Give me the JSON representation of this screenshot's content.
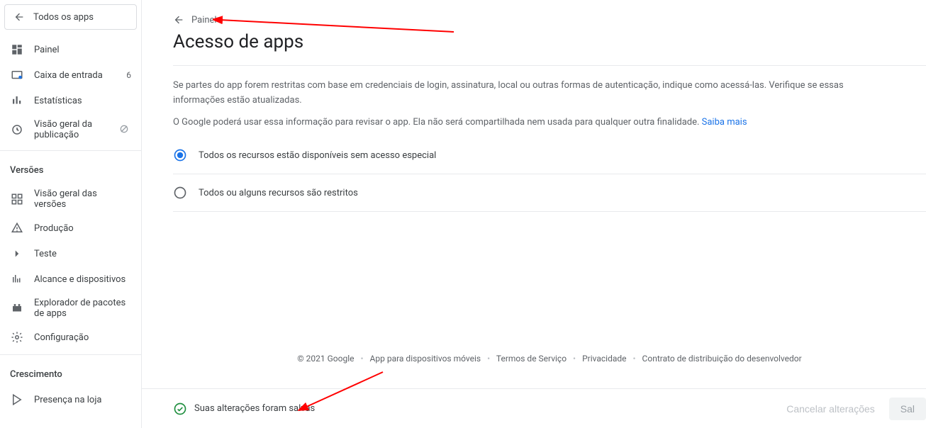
{
  "allApps": "Todos os apps",
  "nav": {
    "painel": "Painel",
    "caixa": "Caixa de entrada",
    "caixa_count": "6",
    "estatisticas": "Estatísticas",
    "visao_pub": "Visão geral da publicação"
  },
  "sec_versoes_title": "Versões",
  "versoes": {
    "visao": "Visão geral das versões",
    "producao": "Produção",
    "teste": "Teste",
    "alcance": "Alcance e dispositivos",
    "explorador": "Explorador de pacotes de apps",
    "config": "Configuração"
  },
  "sec_crescimento_title": "Crescimento",
  "crescimento": {
    "presenca": "Presença na loja"
  },
  "breadcrumb": "Painel",
  "page_title": "Acesso de apps",
  "intro_p1": "Se partes do app forem restritas com base em credenciais de login, assinatura, local ou outras formas de autenticação, indique como acessá-las. Verifique se essas informações estão atualizadas.",
  "intro_p2a": "O Google poderá usar essa informação para revisar o app. Ela não será compartilhada nem usada para qualquer outra finalidade. ",
  "intro_link": "Saiba mais",
  "radio1": "Todos os recursos estão disponíveis sem acesso especial",
  "radio2": "Todos ou alguns recursos são restritos",
  "footer": {
    "copyright": "© 2021 Google",
    "l1": "App para dispositivos móveis",
    "l2": "Termos de Serviço",
    "l3": "Privacidade",
    "l4": "Contrato de distribuição do desenvolvedor"
  },
  "save_msg": "Suas alterações foram salvas",
  "btn_cancel": "Cancelar alterações",
  "btn_save": "Sal"
}
